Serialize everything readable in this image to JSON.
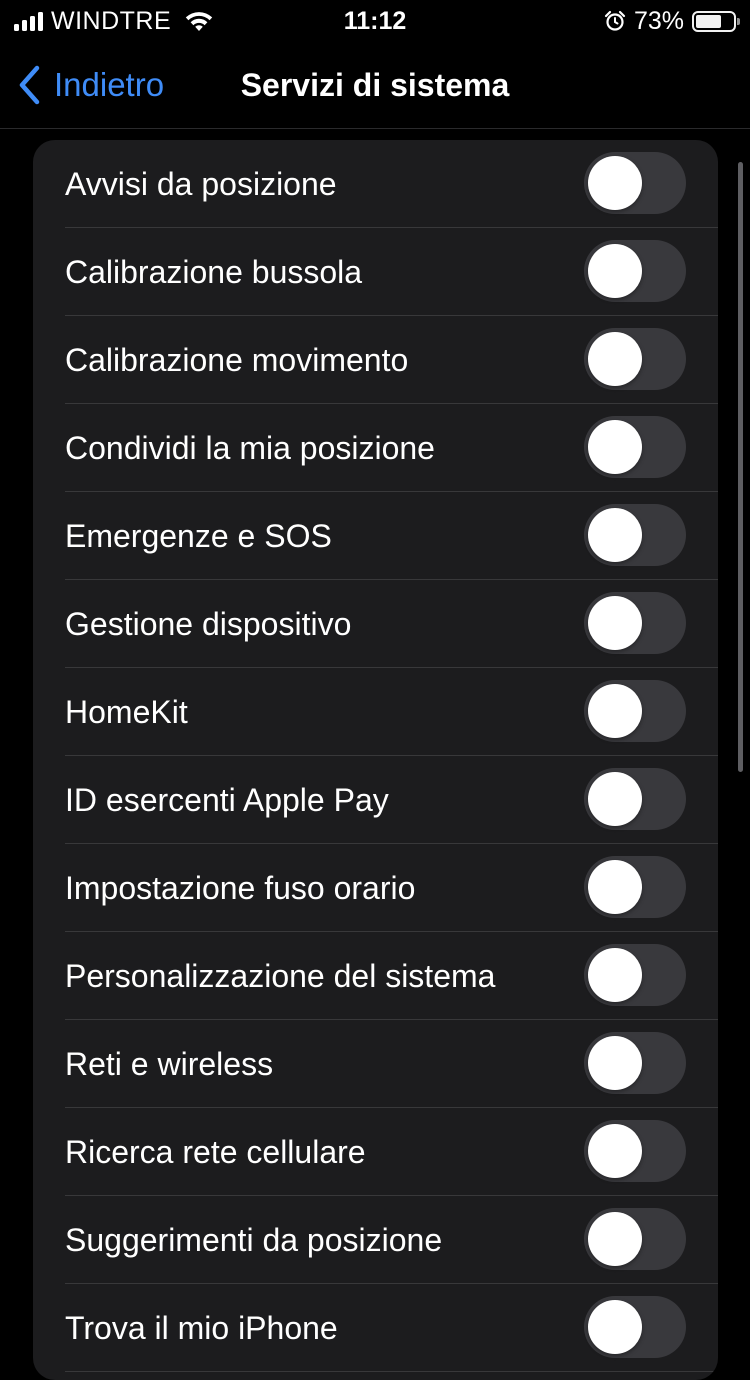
{
  "status_bar": {
    "carrier": "WINDTRE",
    "time": "11:12",
    "battery": "73%",
    "battery_level": 0.73,
    "icons": [
      "signal-icon",
      "wifi-icon",
      "alarm-icon",
      "battery-icon"
    ]
  },
  "nav": {
    "back_label": "Indietro",
    "title": "Servizi di sistema"
  },
  "colors": {
    "accent": "#3f8cf7",
    "background": "#000000",
    "group_background": "#1c1c1e",
    "toggle_off": "#39393d"
  },
  "items": [
    {
      "label": "Avvisi da posizione",
      "on": false
    },
    {
      "label": "Calibrazione bussola",
      "on": false
    },
    {
      "label": "Calibrazione movimento",
      "on": false
    },
    {
      "label": "Condividi la mia posizione",
      "on": false
    },
    {
      "label": "Emergenze e SOS",
      "on": false
    },
    {
      "label": "Gestione dispositivo",
      "on": false
    },
    {
      "label": "HomeKit",
      "on": false
    },
    {
      "label": "ID esercenti Apple Pay",
      "on": false
    },
    {
      "label": "Impostazione fuso orario",
      "on": false
    },
    {
      "label": "Personalizzazione del sistema",
      "on": false
    },
    {
      "label": "Reti e wireless",
      "on": false
    },
    {
      "label": "Ricerca rete cellulare",
      "on": false
    },
    {
      "label": "Suggerimenti da posizione",
      "on": false
    },
    {
      "label": "Trova il mio iPhone",
      "on": false
    }
  ]
}
